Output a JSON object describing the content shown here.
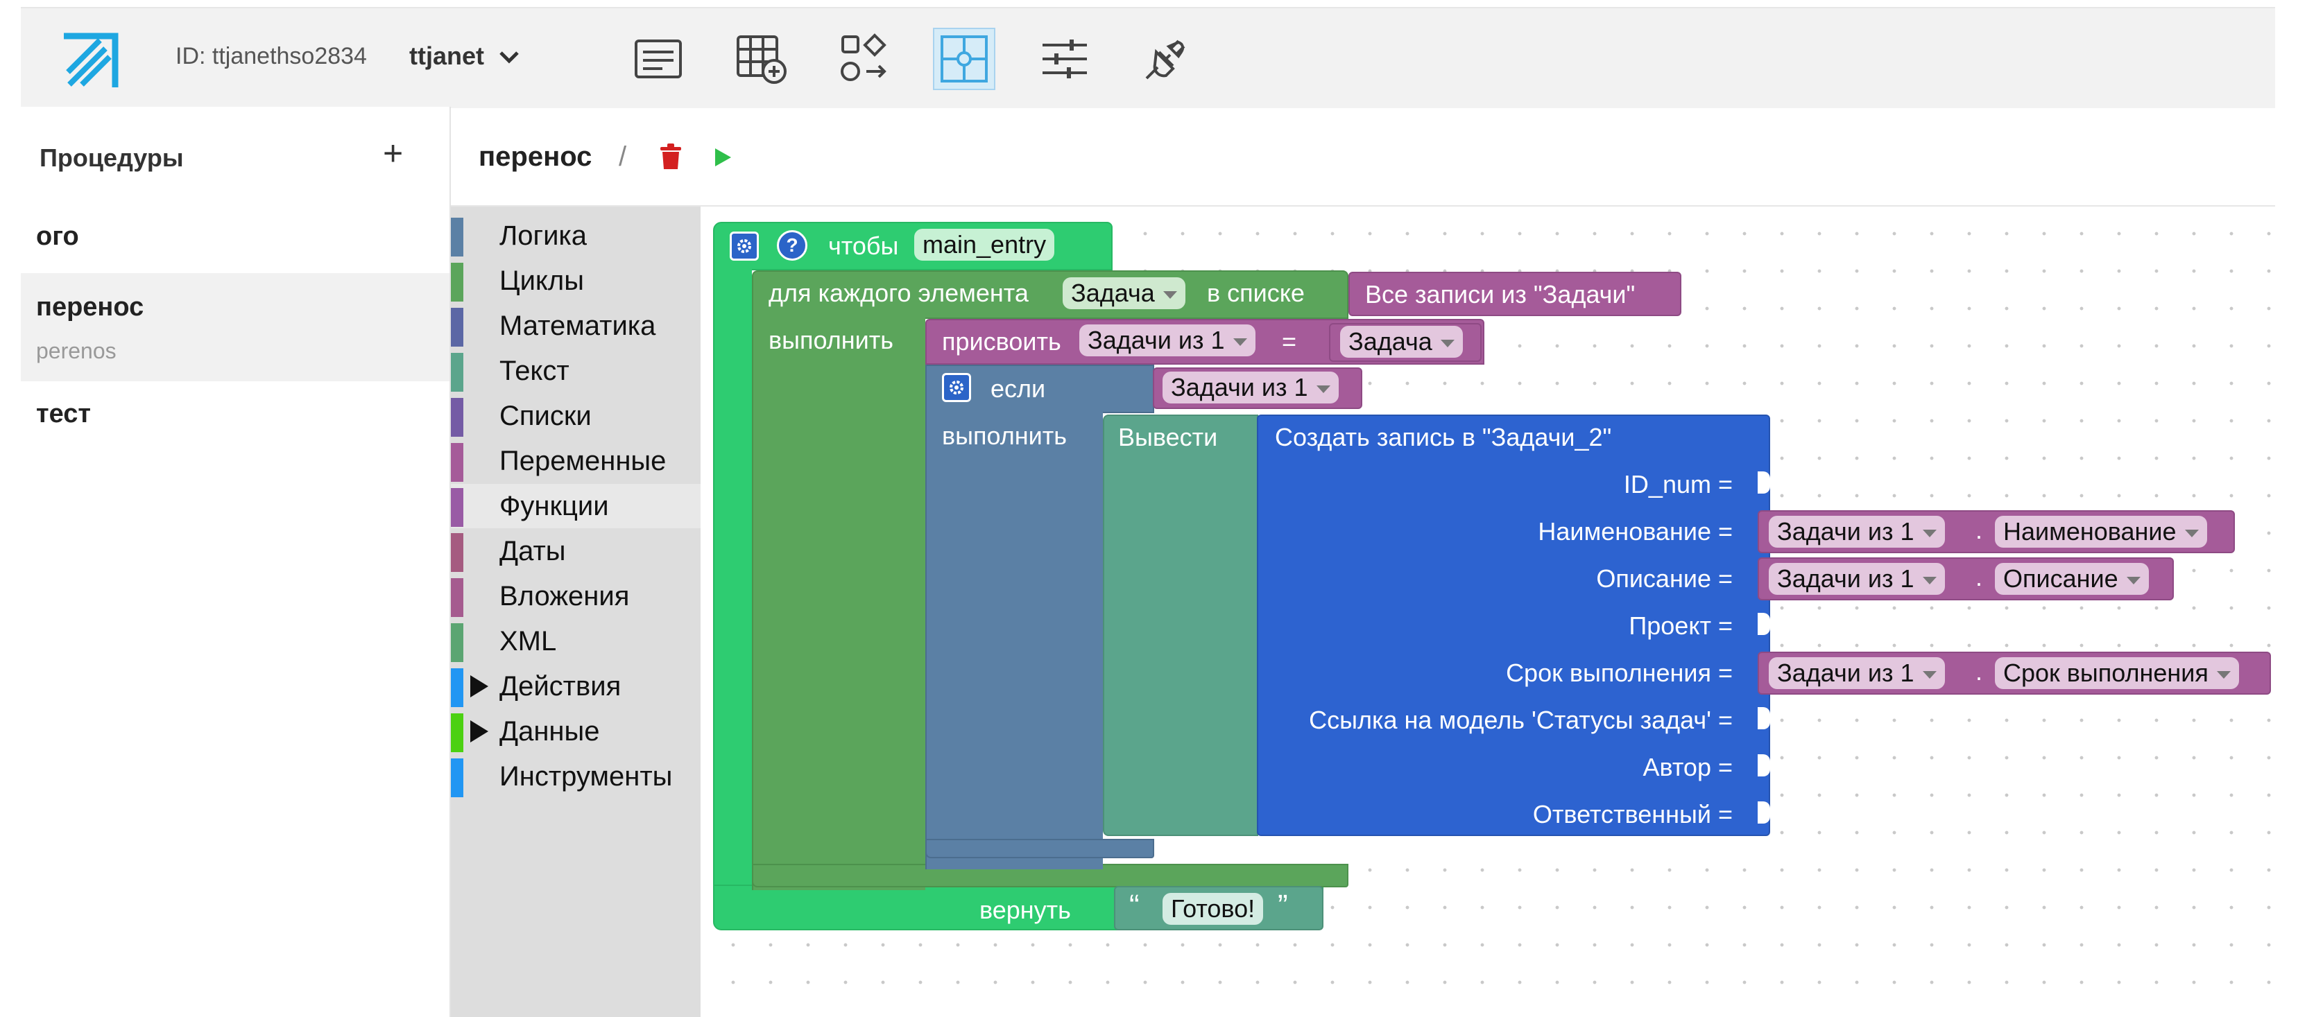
{
  "topbar": {
    "id_label": "ID: ttjanethso2834",
    "user": "ttjanet",
    "icons": [
      "form-icon",
      "table-add-icon",
      "shapes-icon",
      "puzzle-icon",
      "sliders-icon",
      "plug-icon"
    ],
    "active_icon": "puzzle-icon"
  },
  "procedures": {
    "title": "Процедуры",
    "add": "+",
    "items": [
      {
        "title": "ого",
        "subtitle": ""
      },
      {
        "title": "перенос",
        "subtitle": "perenos"
      },
      {
        "title": "тест",
        "subtitle": ""
      }
    ],
    "selected_index": 1
  },
  "editor": {
    "title": "перенос",
    "separator": "/"
  },
  "toolbox": {
    "items": [
      {
        "label": "Логика",
        "color": "#5b80a5",
        "arrow": false
      },
      {
        "label": "Циклы",
        "color": "#5ba55b",
        "arrow": false
      },
      {
        "label": "Математика",
        "color": "#5b67a5",
        "arrow": false
      },
      {
        "label": "Текст",
        "color": "#5ba58c",
        "arrow": false
      },
      {
        "label": "Списки",
        "color": "#745ba5",
        "arrow": false
      },
      {
        "label": "Переменные",
        "color": "#a55b99",
        "arrow": false
      },
      {
        "label": "Функции",
        "color": "#995ba5",
        "arrow": false
      },
      {
        "label": "Даты",
        "color": "#a55b80",
        "arrow": false
      },
      {
        "label": "Вложения",
        "color": "#a55b8f",
        "arrow": false
      },
      {
        "label": "XML",
        "color": "#5ba572",
        "arrow": false
      },
      {
        "label": "Действия",
        "color": "#2196f3",
        "arrow": true
      },
      {
        "label": "Данные",
        "color": "#4cd112",
        "arrow": true
      },
      {
        "label": "Инструменты",
        "color": "#2196f3",
        "arrow": false
      }
    ],
    "highlighted_index": 6
  },
  "blocks": {
    "func_label": "чтобы",
    "func_name": "main_entry",
    "help": "?",
    "foreach_label": "для каждого элемента",
    "foreach_var": "Задача",
    "in_list": "в списке",
    "do_label": "выполнить",
    "all_records": "Все записи из \"Задачи\"",
    "assign_label": "присвоить",
    "assign_var": "Задачи из 1",
    "equals": "=",
    "assign_value": "Задача",
    "if_label": "если",
    "if_value": "Задачи из 1",
    "do_label2": "выполнить",
    "output_label": "Вывести",
    "create_label": "Создать запись в \"Задачи_2\"",
    "fields": [
      {
        "label": "ID_num =",
        "var": "",
        "prop": ""
      },
      {
        "label": "Наименование =",
        "var": "Задачи из 1",
        "prop": "Наименование"
      },
      {
        "label": "Описание =",
        "var": "Задачи из 1",
        "prop": "Описание"
      },
      {
        "label": "Проект =",
        "var": "",
        "prop": ""
      },
      {
        "label": "Срок выполнения =",
        "var": "Задачи из 1",
        "prop": "Срок выполнения"
      },
      {
        "label": "Ссылка на модель 'Статусы задач' =",
        "var": "",
        "prop": ""
      },
      {
        "label": "Автор =",
        "var": "",
        "prop": ""
      },
      {
        "label": "Ответственный =",
        "var": "",
        "prop": ""
      }
    ],
    "dot": ".",
    "return_label": "вернуть",
    "quote_open": "“",
    "return_value": "Готово!",
    "quote_close": "”"
  }
}
